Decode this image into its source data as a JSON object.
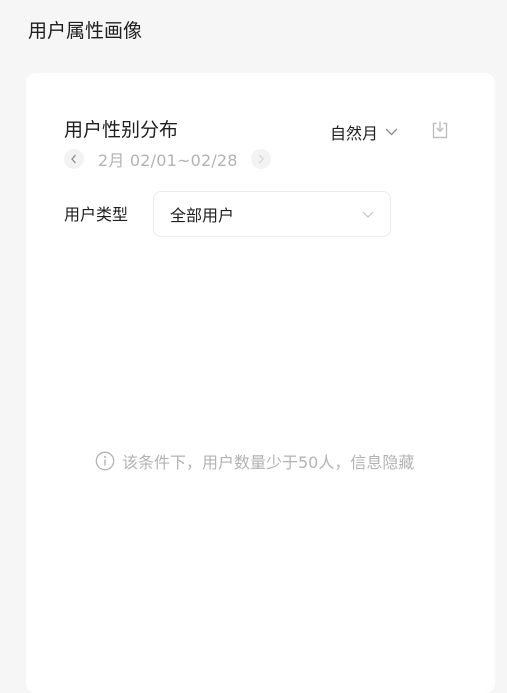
{
  "page": {
    "title": "用户属性画像"
  },
  "card": {
    "title": "用户性别分布",
    "period_select": {
      "value": "自然月",
      "icon": "chevron-down-icon"
    },
    "download_icon": "download-icon",
    "date_nav": {
      "prev_icon": "chevron-left-icon",
      "range_label": "2月 02/01~02/28",
      "next_icon": "chevron-right-icon"
    },
    "filter": {
      "label": "用户类型",
      "value": "全部用户",
      "icon": "chevron-down-icon"
    },
    "empty_state": {
      "icon": "info-icon",
      "message": "该条件下，用户数量少于50人，信息隐藏"
    }
  },
  "colors": {
    "page_background": "#f6f6f6",
    "card_background": "#ffffff",
    "primary_text": "#1f1f1f",
    "muted_text": "#b3b3b3",
    "border": "#ececec"
  }
}
